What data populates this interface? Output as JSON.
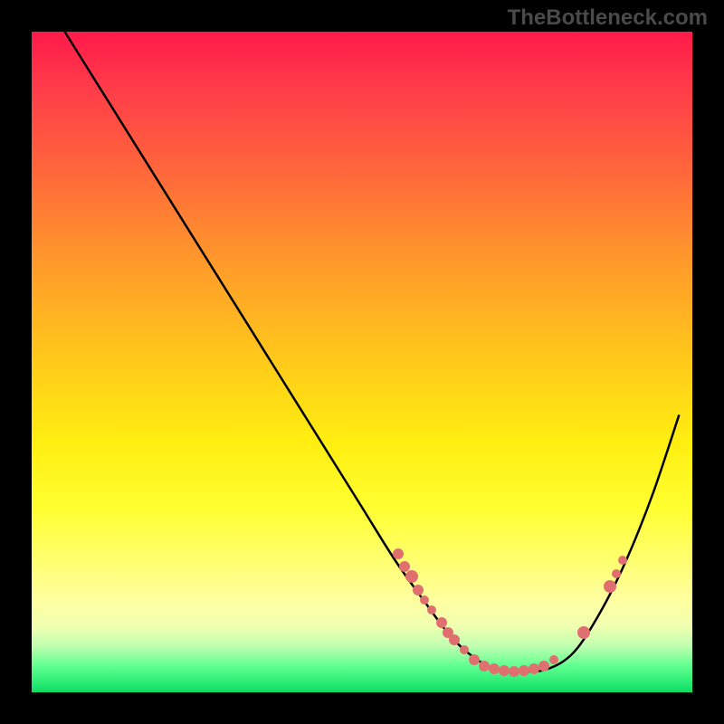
{
  "watermark": "TheBottleneck.com",
  "chart_data": {
    "type": "line",
    "title": "",
    "xlabel": "",
    "ylabel": "",
    "xlim": [
      0,
      100
    ],
    "ylim": [
      0,
      100
    ],
    "description": "Bottleneck curve over a red-to-green vertical gradient. The black curve descends from near the top-left, reaches a flat minimum around x≈70, then rises toward the right. Salmon markers highlight points along the descending and ascending limbs near the trough.",
    "series": [
      {
        "name": "bottleneck-curve",
        "x": [
          5,
          10,
          15,
          20,
          25,
          30,
          35,
          40,
          45,
          50,
          55,
          60,
          63,
          66,
          70,
          74,
          78,
          82,
          86,
          90,
          94,
          98
        ],
        "y": [
          100,
          92,
          84,
          76,
          68,
          60,
          52,
          44,
          36,
          28,
          20,
          13,
          9,
          6,
          3.5,
          3.2,
          3.5,
          6,
          12,
          20,
          30,
          42
        ]
      }
    ],
    "markers": [
      {
        "x": 55.5,
        "y": 21.0,
        "r": 6
      },
      {
        "x": 56.5,
        "y": 19.0,
        "r": 6
      },
      {
        "x": 57.5,
        "y": 17.5,
        "r": 7
      },
      {
        "x": 58.5,
        "y": 15.5,
        "r": 6
      },
      {
        "x": 59.5,
        "y": 14.0,
        "r": 5
      },
      {
        "x": 60.5,
        "y": 12.5,
        "r": 5
      },
      {
        "x": 62.0,
        "y": 10.5,
        "r": 6
      },
      {
        "x": 63.0,
        "y": 9.0,
        "r": 6
      },
      {
        "x": 64.0,
        "y": 8.0,
        "r": 6
      },
      {
        "x": 65.5,
        "y": 6.5,
        "r": 5
      },
      {
        "x": 67.0,
        "y": 5.0,
        "r": 6
      },
      {
        "x": 68.5,
        "y": 4.0,
        "r": 6
      },
      {
        "x": 70.0,
        "y": 3.5,
        "r": 6
      },
      {
        "x": 71.5,
        "y": 3.3,
        "r": 6
      },
      {
        "x": 73.0,
        "y": 3.2,
        "r": 6
      },
      {
        "x": 74.5,
        "y": 3.3,
        "r": 6
      },
      {
        "x": 76.0,
        "y": 3.5,
        "r": 6
      },
      {
        "x": 77.5,
        "y": 4.0,
        "r": 6
      },
      {
        "x": 79.0,
        "y": 5.0,
        "r": 5
      },
      {
        "x": 83.5,
        "y": 9.0,
        "r": 7
      },
      {
        "x": 87.5,
        "y": 16.0,
        "r": 7
      },
      {
        "x": 88.5,
        "y": 18.0,
        "r": 5
      },
      {
        "x": 89.5,
        "y": 20.0,
        "r": 5
      }
    ],
    "gradient_stops": [
      {
        "pos": 0,
        "color": "#ff1a4a"
      },
      {
        "pos": 50,
        "color": "#ffca1a"
      },
      {
        "pos": 85,
        "color": "#ffff90"
      },
      {
        "pos": 100,
        "color": "#10d860"
      }
    ]
  }
}
